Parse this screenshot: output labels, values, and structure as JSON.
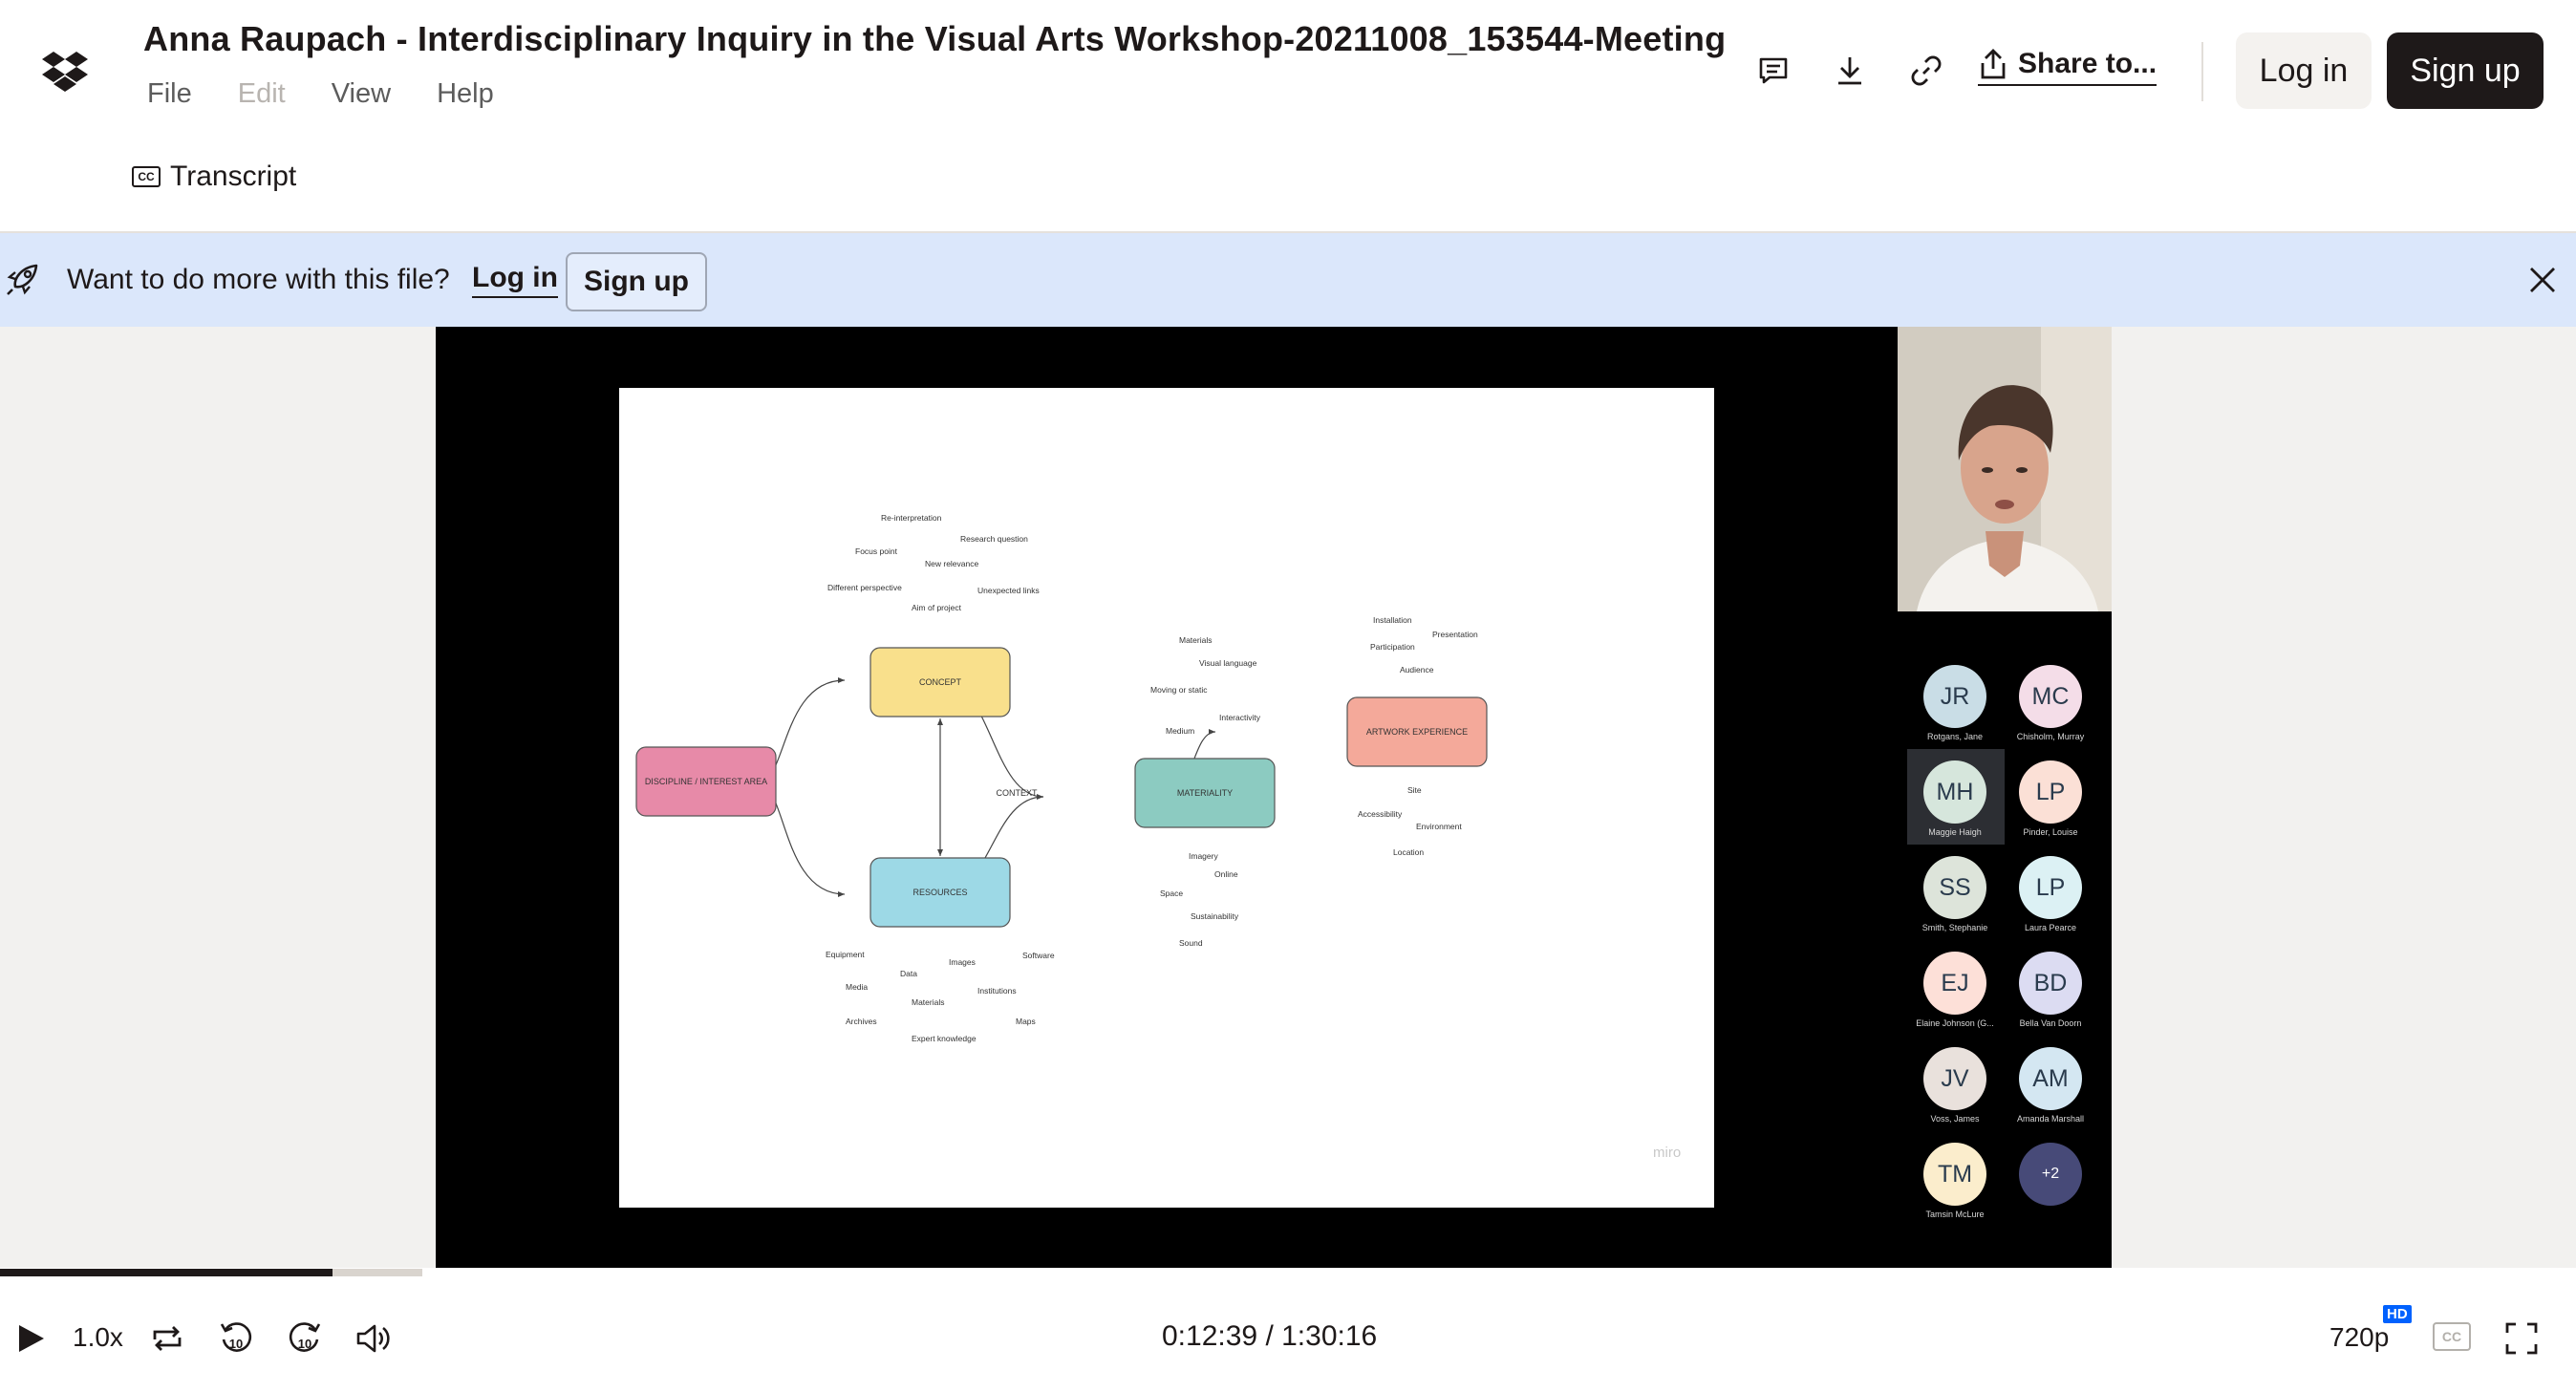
{
  "header": {
    "title": "Anna Raupach - Interdisciplinary Inquiry in the Visual Arts Workshop-20211008_153544-Meeting",
    "menu": [
      {
        "label": "File",
        "enabled": true
      },
      {
        "label": "Edit",
        "enabled": false
      },
      {
        "label": "View",
        "enabled": true
      },
      {
        "label": "Help",
        "enabled": true
      }
    ],
    "transcript_label": "Transcript",
    "cc_icon_text": "CC",
    "icons": [
      "comment-icon",
      "download-icon",
      "link-icon",
      "share-icon"
    ],
    "share_label": "Share to...",
    "login_label": "Log in",
    "signup_label": "Sign up"
  },
  "banner": {
    "text": "Want to do more with this file?",
    "login_label": "Log in",
    "signup_label": "Sign up"
  },
  "slide": {
    "nodes": {
      "discipline": "DISCIPLINE / INTEREST AREA",
      "concept": "CONCEPT",
      "resources": "RESOURCES",
      "materiality": "MATERIALITY",
      "artwork": "ARTWORK EXPERIENCE",
      "context": "CONTEXT"
    },
    "concept_terms": [
      "Re-interpretation",
      "Research question",
      "Focus point",
      "New relevance",
      "Different perspective",
      "Unexpected links",
      "Aim of project"
    ],
    "resources_terms": [
      "Equipment",
      "Images",
      "Software",
      "Data",
      "Media",
      "Institutions",
      "Materials",
      "Archives",
      "Maps",
      "Expert knowledge"
    ],
    "materiality_top_terms": [
      "Materials",
      "Visual language",
      "Moving or static",
      "Interactivity",
      "Medium"
    ],
    "materiality_bottom_terms": [
      "Imagery",
      "Online",
      "Space",
      "Sustainability",
      "Sound"
    ],
    "artwork_top_terms": [
      "Installation",
      "Presentation",
      "Participation",
      "Audience"
    ],
    "artwork_bottom_terms": [
      "Site",
      "Accessibility",
      "Environment",
      "Location"
    ],
    "watermark": "miro"
  },
  "participants": [
    {
      "initials": "JR",
      "name": "Rotgans, Jane",
      "color": "#c9dde6"
    },
    {
      "initials": "MC",
      "name": "Chisholm, Murray",
      "color": "#f4dde8"
    },
    {
      "initials": "MH",
      "name": "Maggie Haigh",
      "color": "#d6e6dc"
    },
    {
      "initials": "LP",
      "name": "Pinder, Louise",
      "color": "#fbe0d6"
    },
    {
      "initials": "SS",
      "name": "Smith, Stephanie",
      "color": "#dde4da"
    },
    {
      "initials": "LP",
      "name": "Laura Pearce",
      "color": "#dcf1f4"
    },
    {
      "initials": "EJ",
      "name": "Elaine Johnson (G...",
      "color": "#fde0d8"
    },
    {
      "initials": "BD",
      "name": "Bella Van Doorn",
      "color": "#dcdcf2"
    },
    {
      "initials": "JV",
      "name": "Voss, James",
      "color": "#e9e1dc"
    },
    {
      "initials": "AM",
      "name": "Amanda Marshall",
      "color": "#d4e7f2"
    },
    {
      "initials": "TM",
      "name": "Tamsin McLure",
      "color": "#fbedcc"
    },
    {
      "initials": "+2",
      "name": "",
      "color": "#474a78"
    }
  ],
  "player": {
    "progress": 0.14,
    "speed": "1.0x",
    "skip_back": "10",
    "skip_forward": "10",
    "current_time": "0:12:39",
    "separator": "/",
    "duration": "1:30:16",
    "quality": "720p",
    "hd_badge": "HD",
    "cc_label": "CC"
  },
  "colors": {
    "concept": "#f9e08c",
    "resources": "#9dd9e6",
    "materiality": "#8ccbc1",
    "artwork": "#f4a99a",
    "discipline": "#e78aa8",
    "banner": "#dbe7fb",
    "brand_blue": "#0061fe"
  }
}
